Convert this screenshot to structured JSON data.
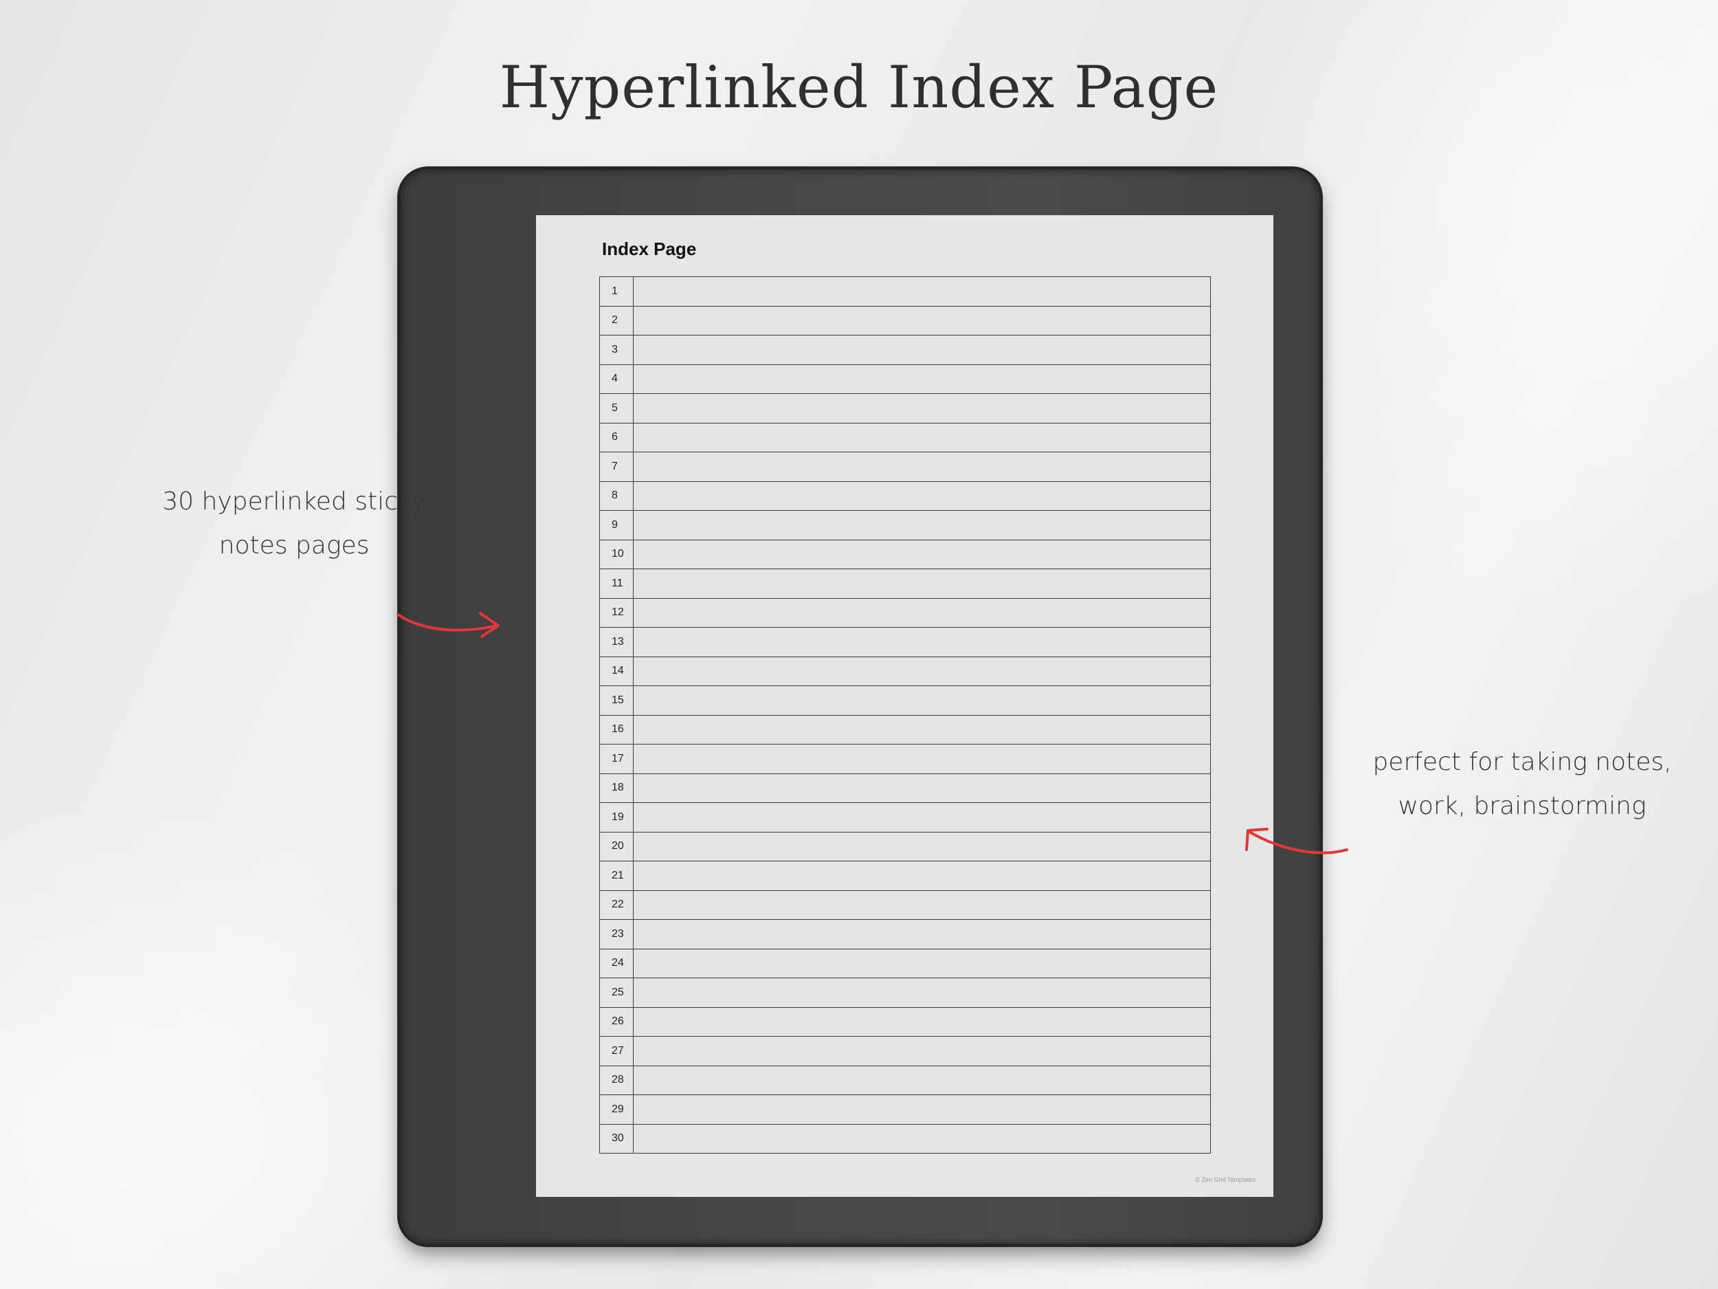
{
  "headline": "Hyperlinked Index Page",
  "annotations": {
    "left": "30 hyperlinked sticky notes pages",
    "right": "perfect for taking notes, work, brainstorming"
  },
  "screen": {
    "title": "Index Page",
    "credit": "© Zen Grid Templates",
    "rows": [
      "1",
      "2",
      "3",
      "4",
      "5",
      "6",
      "7",
      "8",
      "9",
      "10",
      "11",
      "12",
      "13",
      "14",
      "15",
      "16",
      "17",
      "18",
      "19",
      "20",
      "21",
      "22",
      "23",
      "24",
      "25",
      "26",
      "27",
      "28",
      "29",
      "30"
    ]
  },
  "colors": {
    "arrow": "#e0383b",
    "screen": "#e6e6e6",
    "tablet": "#454545"
  },
  "icons": {
    "left_arrow": "curved-arrow-right",
    "right_arrow": "curved-arrow-left"
  }
}
